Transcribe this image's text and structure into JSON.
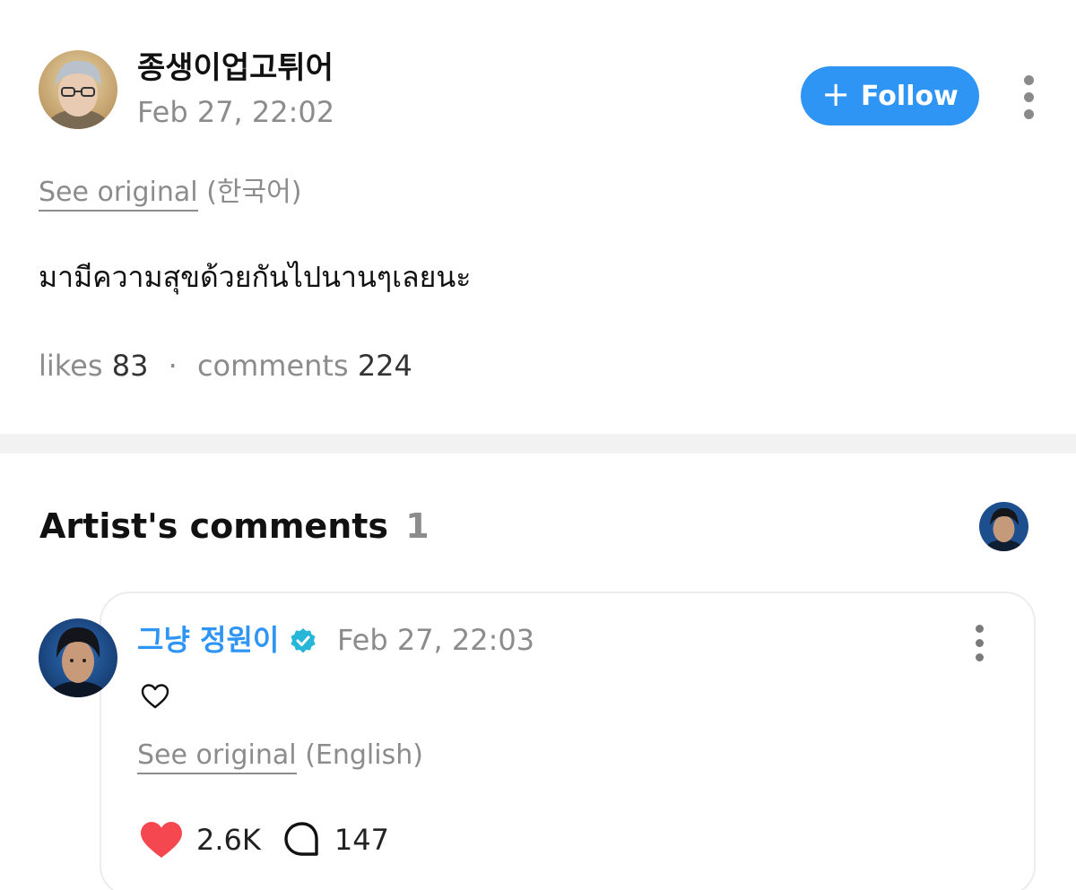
{
  "post": {
    "author_name": "종생이업고튀어",
    "date": "Feb 27, 22:02",
    "follow_label": "Follow",
    "see_original_label": "See original",
    "original_language": "(한국어)",
    "body": "มามีความสุขด้วยกันไปนานๆเลยนะ",
    "likes_label": "likes",
    "likes_count": "83",
    "separator": "·",
    "comments_label": "comments",
    "comments_count": "224"
  },
  "artist_comments": {
    "heading": "Artist's comments",
    "count": "1",
    "comment": {
      "author_name": "그냥 정원이",
      "date": "Feb 27, 22:03",
      "see_original_label": "See original",
      "original_language": "(English)",
      "likes": "2.6K",
      "replies": "147"
    }
  },
  "colors": {
    "accent": "#2f95f5",
    "muted_text": "#8c8c8c",
    "heart": "#f5474f",
    "verified": "#25b6d8"
  },
  "icons": {
    "follow": "plus-icon",
    "more": "more-vertical-icon",
    "verified": "verified-badge-icon",
    "comment_text": "heart-outline-icon",
    "like": "heart-filled-icon",
    "reply": "speech-bubble-icon"
  }
}
